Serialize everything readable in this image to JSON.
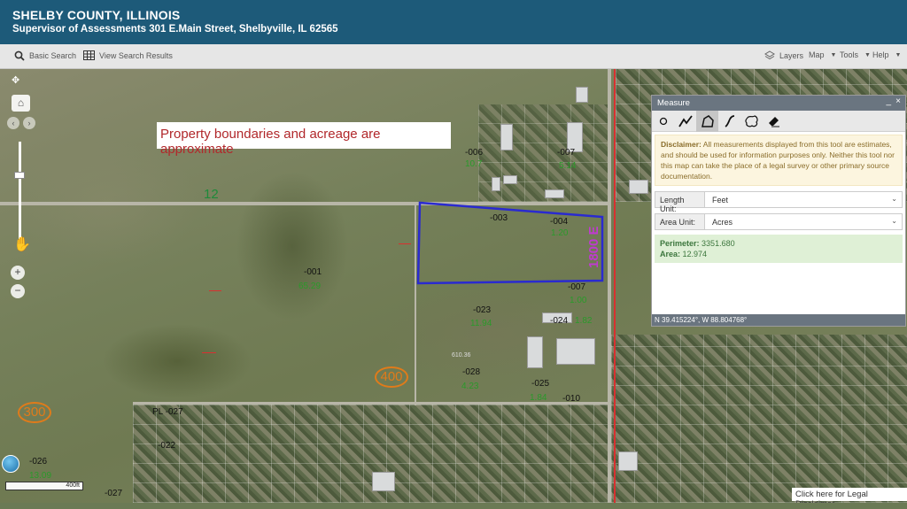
{
  "header": {
    "title": "SHELBY COUNTY, ILLINOIS",
    "subtitle": "Supervisor of Assessments 301 E.Main Street, Shelbyville, IL 62565"
  },
  "toolbar": {
    "basic_search": "Basic Search",
    "view_results": "View Search Results",
    "layers": "Layers",
    "map": "Map",
    "tools": "Tools",
    "help": "Help"
  },
  "map": {
    "banner": "Property boundaries and acreage are approximate",
    "road_labels": {
      "r12": "12",
      "r400": "400",
      "r300": "300",
      "r1800e": "1800 E"
    },
    "parcels": {
      "p006": "-006",
      "a006": "10.7",
      "p007a": "-007",
      "a007a": "5.14",
      "p003": "-003",
      "p004": "-004",
      "a004": "1.20",
      "p001": "-001",
      "a001": "65.29",
      "p007b": "-007",
      "a007b": "1.00",
      "p023": "-023",
      "a023": "11.94",
      "p024": "-024",
      "a024": "1.82",
      "p028": "-028",
      "a028": "4.23",
      "p025": "-025",
      "a025": "1.84",
      "p010": "-010",
      "p027a": "PL -027",
      "p022": "-022",
      "p026": "-026",
      "a026": "13.09",
      "p027b": "-027",
      "dim": "610.36"
    },
    "scale": "400ft",
    "legal": "Click here for Legal Disclaimer"
  },
  "measure": {
    "title": "Measure",
    "disclaimer_bold": "Disclaimer:",
    "disclaimer_text": " All measurements displayed from this tool are estimates, and should be used for information purposes only. Neither this tool nor this map can take the place of a legal survey or other primary source documentation.",
    "length_label": "Length Unit:",
    "length_value": "Feet",
    "area_label": "Area Unit:",
    "area_value": "Acres",
    "perimeter_label": "Perimeter:",
    "perimeter_value": "3351.680",
    "area_result_label": "Area:",
    "area_result_value": "12.974",
    "coords": "N 39.415224°, W 88.804768°"
  }
}
